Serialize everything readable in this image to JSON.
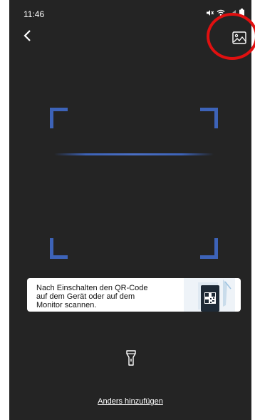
{
  "status_bar": {
    "time": "11:46"
  },
  "toolbar": {
    "back_icon": "chevron-left-icon",
    "gallery_icon": "image-icon"
  },
  "annotation": {
    "highlight_color": "#e01010"
  },
  "scanner": {
    "accent_color": "#3d63b8"
  },
  "hint": {
    "text": "Nach Einschalten den QR-Code\nauf dem Gerät oder auf dem\nMonitor scannen."
  },
  "flashlight": {
    "icon": "flashlight-icon"
  },
  "footer": {
    "alt_link": "Anders hinzufügen"
  }
}
